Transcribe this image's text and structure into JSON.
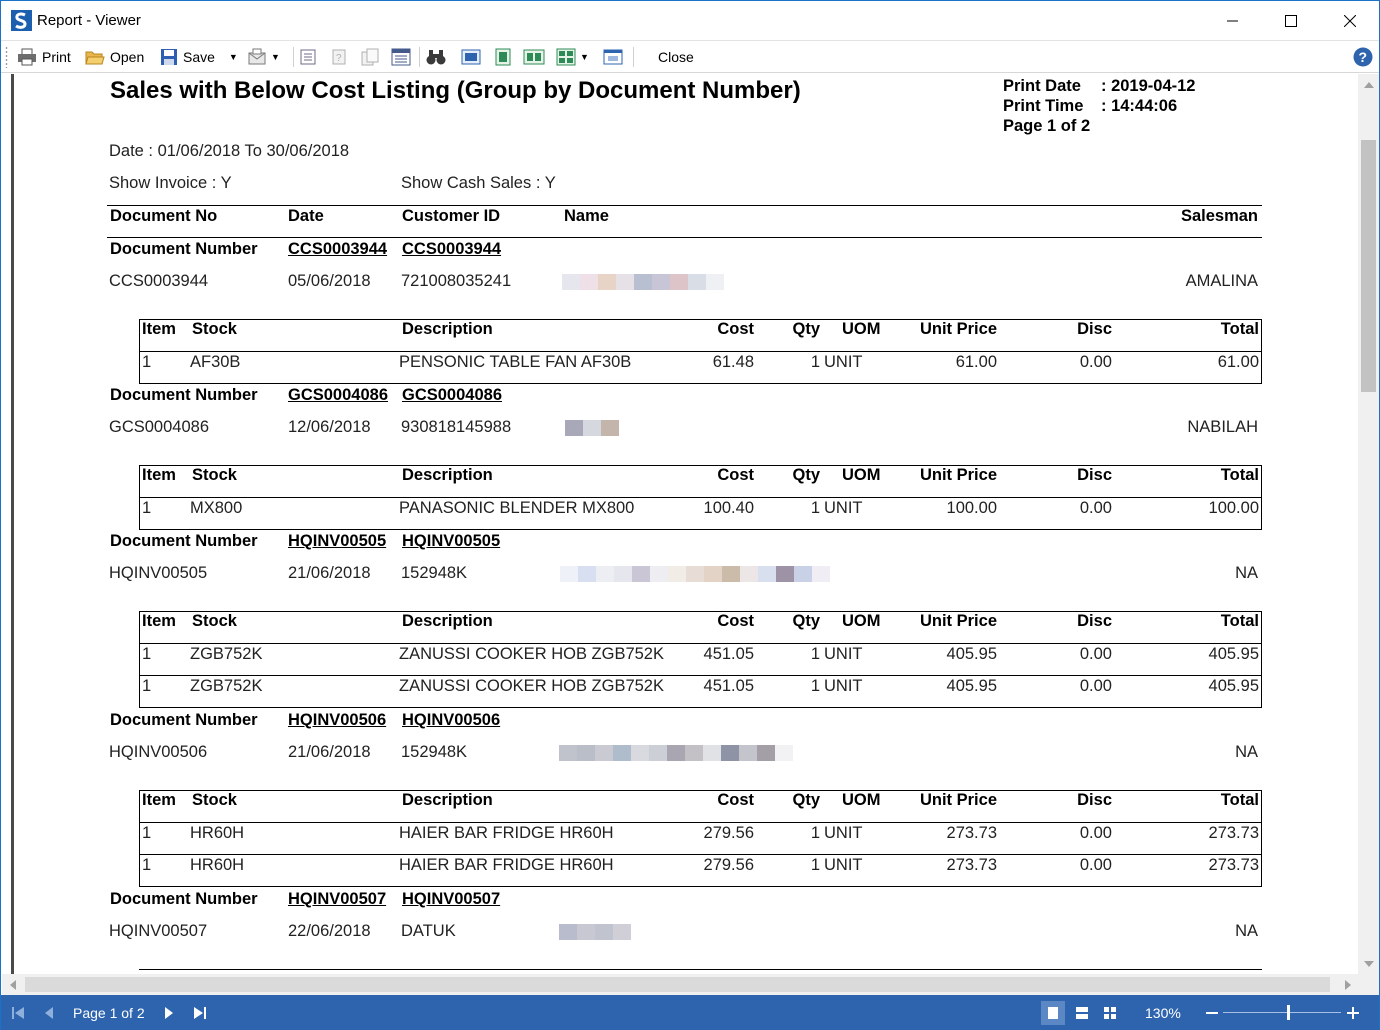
{
  "window": {
    "title": "Report - Viewer"
  },
  "toolbar": {
    "print_label": "Print",
    "open_label": "Open",
    "save_label": "Save",
    "close_label": "Close"
  },
  "report": {
    "title": "Sales with Below Cost Listing (Group by Document Number)",
    "print_date_label": "Print Date",
    "print_date": ": 2019-04-12",
    "print_time_label": "Print Time",
    "print_time": ": 14:44:06",
    "page_label": "Page 1 of 2",
    "date_range": "Date : 01/06/2018 To 30/06/2018",
    "show_invoice": "Show Invoice : Y",
    "show_cash_sales": "Show Cash Sales : Y",
    "columns": {
      "document_no": "Document No",
      "date": "Date",
      "customer_id": "Customer ID",
      "name": "Name",
      "salesman": "Salesman"
    },
    "item_columns": {
      "item": "Item",
      "stock": "Stock",
      "description": "Description",
      "cost": "Cost",
      "qty": "Qty",
      "uom": "UOM",
      "unit_price": "Unit Price",
      "disc": "Disc",
      "total": "Total"
    },
    "group_label": "Document Number",
    "groups": [
      {
        "doc_a": "CCS0003944",
        "doc_b": "CCS0003944",
        "document_no": "CCS0003944",
        "date": "05/06/2018",
        "customer_id": "721008035241",
        "salesman": "AMALINA",
        "items": [
          {
            "item": "1",
            "stock": "AF30B",
            "description": "PENSONIC TABLE FAN AF30B",
            "cost": "61.48",
            "qty": "1",
            "uom": "UNIT",
            "unit_price": "61.00",
            "disc": "0.00",
            "total": "61.00"
          }
        ]
      },
      {
        "doc_a": "GCS0004086",
        "doc_b": "GCS0004086",
        "document_no": "GCS0004086",
        "date": "12/06/2018",
        "customer_id": "930818145988",
        "salesman": "NABILAH",
        "items": [
          {
            "item": "1",
            "stock": "MX800",
            "description": "PANASONIC BLENDER MX800",
            "cost": "100.40",
            "qty": "1",
            "uom": "UNIT",
            "unit_price": "100.00",
            "disc": "0.00",
            "total": "100.00"
          }
        ]
      },
      {
        "doc_a": "HQINV00505",
        "doc_b": "HQINV00505",
        "document_no": "HQINV00505",
        "date": "21/06/2018",
        "customer_id": "152948K",
        "salesman": "NA",
        "items": [
          {
            "item": "1",
            "stock": "ZGB752K",
            "description": "ZANUSSI COOKER HOB ZGB752K",
            "cost": "451.05",
            "qty": "1",
            "uom": "UNIT",
            "unit_price": "405.95",
            "disc": "0.00",
            "total": "405.95"
          },
          {
            "item": "1",
            "stock": "ZGB752K",
            "description": "ZANUSSI COOKER HOB ZGB752K",
            "cost": "451.05",
            "qty": "1",
            "uom": "UNIT",
            "unit_price": "405.95",
            "disc": "0.00",
            "total": "405.95"
          }
        ]
      },
      {
        "doc_a": "HQINV00506",
        "doc_b": "HQINV00506",
        "document_no": "HQINV00506",
        "date": "21/06/2018",
        "customer_id": "152948K",
        "salesman": "NA",
        "items": [
          {
            "item": "1",
            "stock": "HR60H",
            "description": "HAIER  BAR FRIDGE HR60H",
            "cost": "279.56",
            "qty": "1",
            "uom": "UNIT",
            "unit_price": "273.73",
            "disc": "0.00",
            "total": "273.73"
          },
          {
            "item": "1",
            "stock": "HR60H",
            "description": "HAIER  BAR FRIDGE HR60H",
            "cost": "279.56",
            "qty": "1",
            "uom": "UNIT",
            "unit_price": "273.73",
            "disc": "0.00",
            "total": "273.73"
          }
        ]
      },
      {
        "doc_a": "HQINV00507",
        "doc_b": "HQINV00507",
        "document_no": "HQINV00507",
        "date": "22/06/2018",
        "customer_id": "DATUK",
        "salesman": "NA",
        "items": []
      }
    ]
  },
  "statusbar": {
    "page_indicator": "Page 1 of 2",
    "zoom": "130%"
  },
  "colors": {
    "statusbar": "#2e64ad",
    "window_border": "#1a73c9"
  }
}
